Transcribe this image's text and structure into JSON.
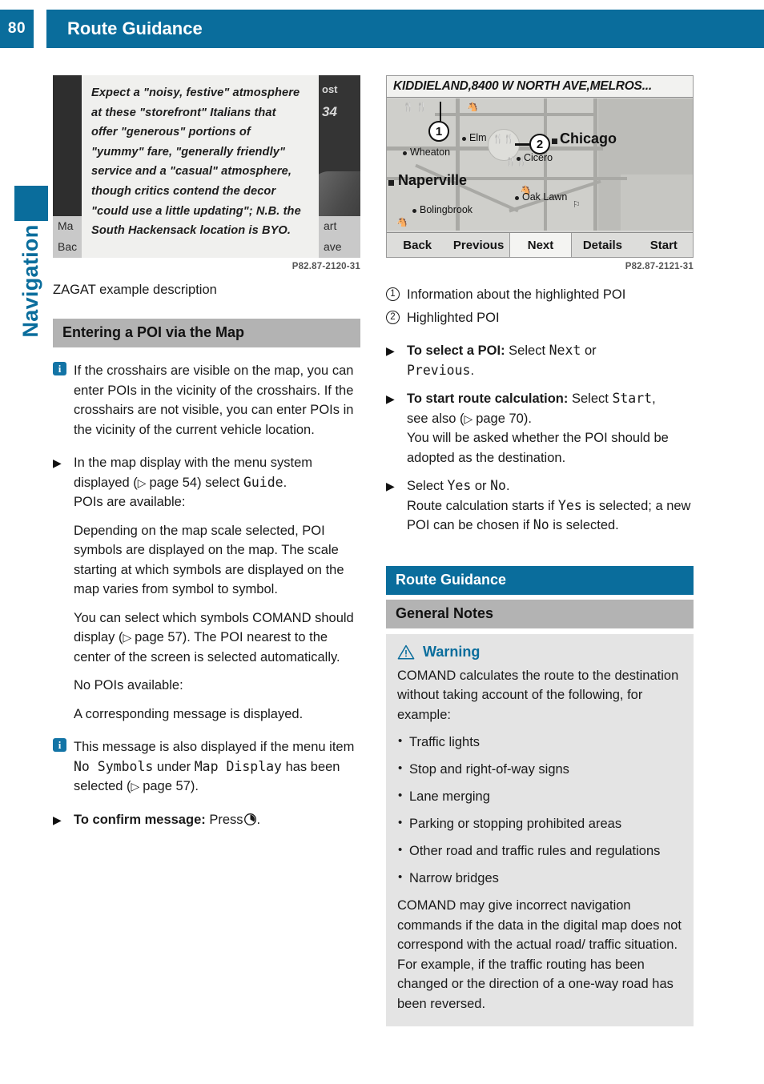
{
  "header": {
    "page_number": "80",
    "title": "Route Guidance",
    "accent_color": "#0a6d9c"
  },
  "side_tab": {
    "label": "Navigation"
  },
  "figures": {
    "zagat": {
      "code": "P82.87-2120-31",
      "caption": "ZAGAT example description",
      "lines": [
        "Expect a \"noisy, festive\" atmosphere",
        "at these \"storefront\" Italians that",
        "offer \"generous\" portions of",
        "\"yummy\" fare, \"generally friendly\"",
        "service and a \"casual\" atmosphere,",
        "though critics contend the decor",
        "\"could use a little updating\"; N.B. the",
        "South Hackensack location is BYO."
      ],
      "edge_fragments": {
        "top_right": "ost",
        "below_right": "34",
        "row1_left": "Ma",
        "row1_right": "art",
        "row2_left": "Bac",
        "row2_right": "ave"
      }
    },
    "map": {
      "code": "P82.87-2121-31",
      "title": "KIDDIELAND,8400 W NORTH AVE,MELROS...",
      "callouts": [
        "1",
        "2"
      ],
      "cities": [
        {
          "name": "Elm",
          "type": "dot"
        },
        {
          "name": "Chicago",
          "type": "square"
        },
        {
          "name": "Wheaton",
          "type": "dot"
        },
        {
          "name": "Cicero",
          "type": "dot"
        },
        {
          "name": "Naperville",
          "type": "square"
        },
        {
          "name": "Oak Lawn",
          "type": "dot"
        },
        {
          "name": "Bolingbrook",
          "type": "dot"
        }
      ],
      "buttons": [
        "Back",
        "Previous",
        "Next",
        "Details",
        "Start"
      ],
      "selected_button": "Next"
    }
  },
  "left_column": {
    "section_heading": "Entering a POI via the Map",
    "info_1": "If the crosshairs are visible on the map, you can enter POIs in the vicinity of the crosshairs. If the crosshairs are not visible, you can enter POIs in the vicinity of the current vehicle location.",
    "step_1_pre": "In the map display with the menu system displayed (",
    "step_1_ref": "page 54",
    "step_1_mid": ") select ",
    "step_1_mono": "Guide",
    "step_1_post": ".",
    "step_1_sub": "POIs are available:",
    "para_1": "Depending on the map scale selected, POI symbols are displayed on the map. The scale starting at which symbols are displayed on the map varies from symbol to symbol.",
    "para_2_pre": "You can select which symbols COMAND should display (",
    "para_2_ref": "page 57",
    "para_2_post": "). The POI nearest to the center of the screen is selected automatically.",
    "para_3": "No POIs available:",
    "para_4": "A corresponding message is displayed.",
    "info_2_pre": "This message is also displayed if the menu item ",
    "info_2_mono_1": "No Symbols",
    "info_2_mid": " under ",
    "info_2_mono_2": "Map Display",
    "info_2_post": " has been selected (",
    "info_2_ref": "page 57",
    "info_2_end": ").",
    "confirm_bold": "To confirm message:",
    "confirm_rest": "Press",
    "confirm_icon": "controller-knob-icon"
  },
  "right_column": {
    "legend": [
      {
        "num": "1",
        "text": "Information about the highlighted POI"
      },
      {
        "num": "2",
        "text": "Highlighted POI"
      }
    ],
    "step_select_bold": "To select a POI:",
    "step_select_pre": "Select ",
    "step_select_mono_1": "Next",
    "step_select_mid": " or",
    "step_select_mono_2": "Previous",
    "step_select_post": ".",
    "step_start_bold": "To start route calculation:",
    "step_start_pre": "Select ",
    "step_start_mono": "Start",
    "step_start_post": ",",
    "step_start_see_pre": "see also (",
    "step_start_ref": "page 70",
    "step_start_see_post": ").",
    "step_start_sub": "You will be asked whether the POI should be adopted as the destination.",
    "step_yesno_pre": "Select ",
    "step_yesno_mono_1": "Yes",
    "step_yesno_mid": " or ",
    "step_yesno_mono_2": "No",
    "step_yesno_post": ".",
    "step_yesno_sub_pre": "Route calculation starts if ",
    "step_yesno_sub_mono_1": "Yes",
    "step_yesno_sub_mid": " is selected; a new POI can be chosen if ",
    "step_yesno_sub_mono_2": "No",
    "step_yesno_sub_post": " is selected.",
    "section_blue": "Route Guidance",
    "section_gray": "General Notes",
    "warning": {
      "label": "Warning",
      "intro": "COMAND calculates the route to the destination without taking account of the following, for example:",
      "items": [
        "Traffic lights",
        "Stop and right-of-way signs",
        "Lane merging",
        "Parking or stopping prohibited areas",
        "Other road and traffic rules and regulations",
        "Narrow bridges"
      ],
      "outro": "COMAND may give incorrect navigation commands if the data in the digital map does not correspond with the actual road/ traffic situation. For example, if the traffic routing has been changed or the direction of a one-way road has been reversed."
    }
  }
}
